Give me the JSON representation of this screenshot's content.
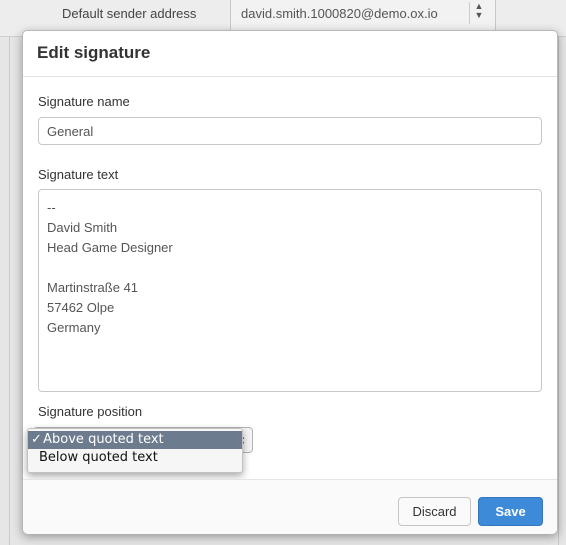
{
  "background": {
    "sender_label": "Default sender address",
    "sender_value": "david.smith.1000820@demo.ox.io"
  },
  "modal": {
    "title": "Edit signature",
    "name_label": "Signature name",
    "name_value": "General",
    "text_label": "Signature text",
    "text_lines": [
      "--",
      "David Smith",
      "Head Game Designer",
      "",
      "Martinstraße 41",
      "57462 Olpe",
      "Germany"
    ],
    "position_label": "Signature position",
    "position_options": [
      {
        "label": "Above quoted text",
        "selected": true
      },
      {
        "label": "Below quoted text",
        "selected": false
      }
    ],
    "check_mark": "✓",
    "discard_label": "Discard",
    "save_label": "Save"
  },
  "colors": {
    "primary": "#3c8ad8",
    "highlight": "#6d7b8f"
  },
  "icons": {
    "select_arrows": "up-down-arrows-icon"
  }
}
